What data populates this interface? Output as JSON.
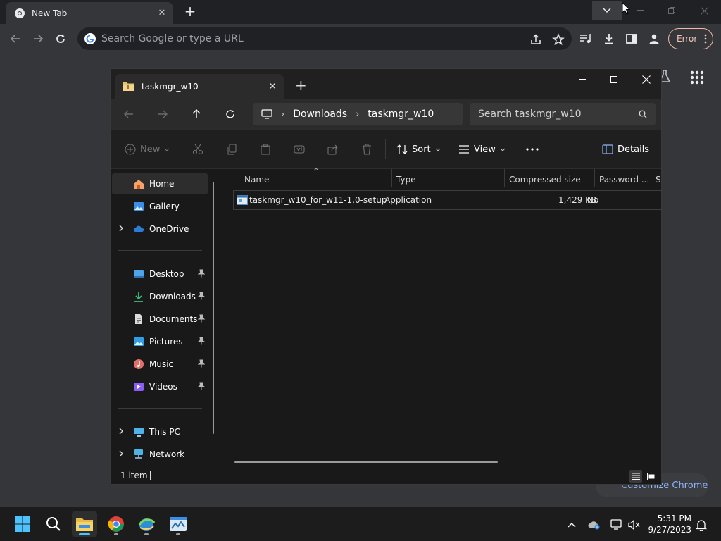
{
  "chrome": {
    "tab_title": "New Tab",
    "omnibox_placeholder": "Search Google or type a URL",
    "profile_status": "Error",
    "customize_label": "Customize Chrome"
  },
  "explorer": {
    "tab_title": "taskmgr_w10",
    "breadcrumb": [
      "Downloads",
      "taskmgr_w10"
    ],
    "search_placeholder": "Search taskmgr_w10",
    "commands": {
      "new": "New",
      "sort": "Sort",
      "view": "View",
      "details": "Details"
    },
    "nav": {
      "home": "Home",
      "gallery": "Gallery",
      "onedrive": "OneDrive",
      "desktop": "Desktop",
      "downloads": "Downloads",
      "documents": "Documents",
      "pictures": "Pictures",
      "music": "Music",
      "videos": "Videos",
      "this_pc": "This PC",
      "network": "Network"
    },
    "columns": {
      "name": "Name",
      "type": "Type",
      "compressed_size": "Compressed size",
      "password": "Password ...",
      "size": "Si"
    },
    "files": [
      {
        "name": "taskmgr_w10_for_w11-1.0-setup",
        "type": "Application",
        "compressed_size": "1,429 KB",
        "password": "No"
      }
    ],
    "status": "1 item"
  },
  "taskbar": {
    "time": "5:31 PM",
    "date": "9/27/2023"
  }
}
